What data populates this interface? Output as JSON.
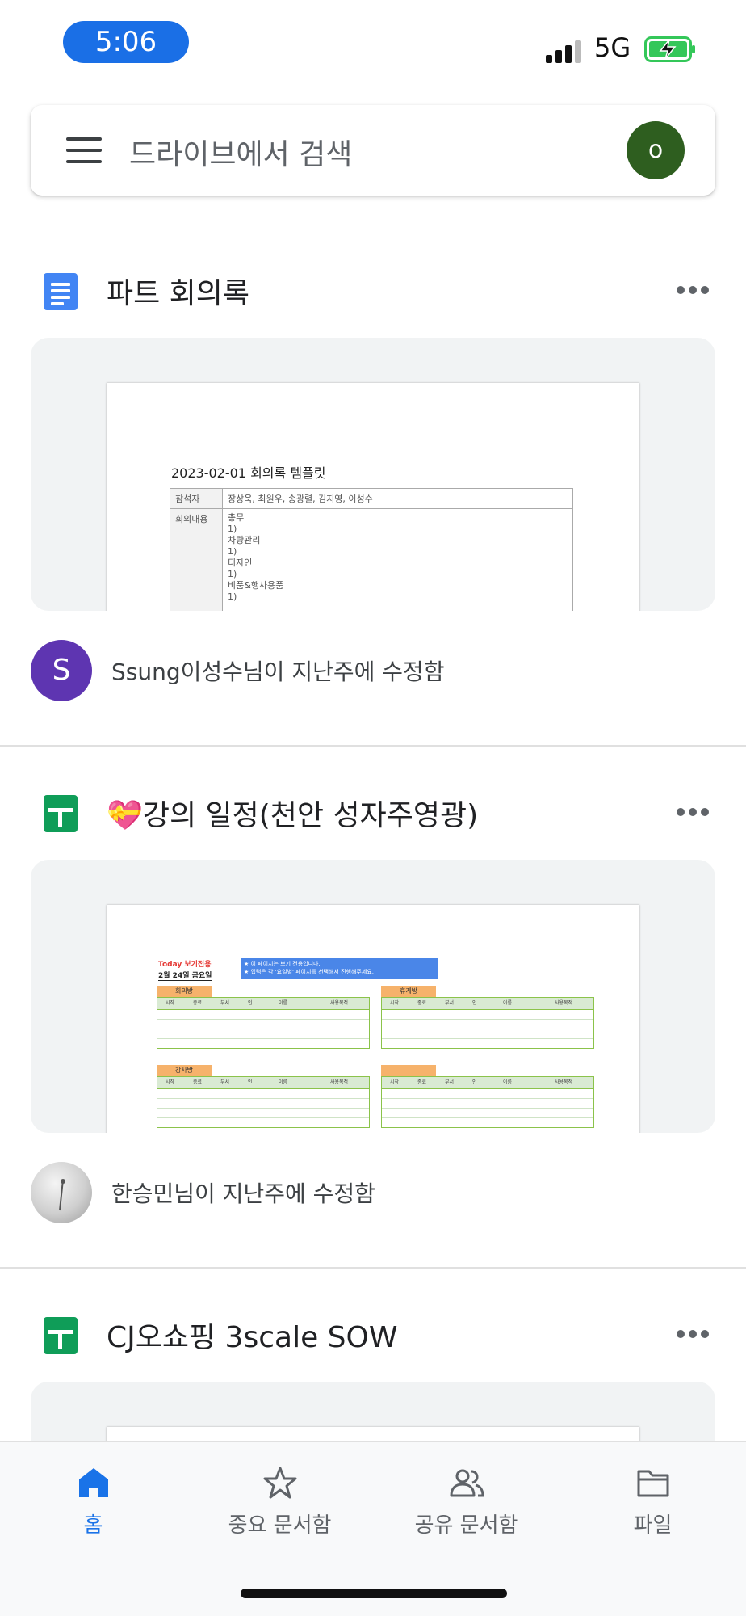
{
  "status_bar": {
    "time": "5:06",
    "network": "5G"
  },
  "search": {
    "placeholder": "드라이브에서 검색",
    "account_initial": "o"
  },
  "files": [
    {
      "type": "docs",
      "title": "파트 회의록",
      "modified_by": "Ssung이성수님이 지난주에 수정함",
      "avatar_initial": "S",
      "avatar_color": "#5e35b1",
      "preview": {
        "heading": "2023-02-01 회의록 템플릿",
        "rows": [
          {
            "label": "참석자",
            "value": "장상욱, 최원우, 송광렬, 김지영, 이성수"
          },
          {
            "label": "회의내용",
            "value": "총무\n  1)\n차량관리\n  1)\n디자인\n  1)\n비품&행사용품\n  1)"
          }
        ]
      }
    },
    {
      "type": "sheets",
      "title": "💝강의 일정(천안 성자주영광)",
      "modified_by": "한승민님이 지난주에 수정함",
      "avatar_initial": "",
      "avatar_color": "#c8c8c8",
      "preview": {
        "today": "Today 보기전용",
        "date": "2월 24일 금요일",
        "banner": "★ 이 페이지는 보기 전용입니다.\n★ 입력은 각 '요일별' 페이지를 선택해서 진행해주세요.",
        "rooms": [
          "회의방",
          "휴게방",
          "강사방",
          ""
        ],
        "columns": [
          "시작",
          "종료",
          "부서",
          "인",
          "이름",
          "사용목적"
        ]
      }
    },
    {
      "type": "sheets",
      "title": "CJ오쇼핑 3scale SOW",
      "modified_by": "",
      "avatar_initial": "",
      "avatar_color": "#c8c8c8"
    }
  ],
  "bottom_nav": [
    {
      "label": "홈",
      "icon": "home-icon",
      "active": true
    },
    {
      "label": "중요 문서함",
      "icon": "star-icon",
      "active": false
    },
    {
      "label": "공유 문서함",
      "icon": "people-icon",
      "active": false
    },
    {
      "label": "파일",
      "icon": "folder-icon",
      "active": false
    }
  ],
  "colors": {
    "accent": "#1a73e8",
    "time_pill": "#1a6fe6",
    "battery": "#34c759",
    "docs": "#4285f4",
    "sheets": "#0f9d58",
    "account_avatar": "#2e5e1f"
  }
}
